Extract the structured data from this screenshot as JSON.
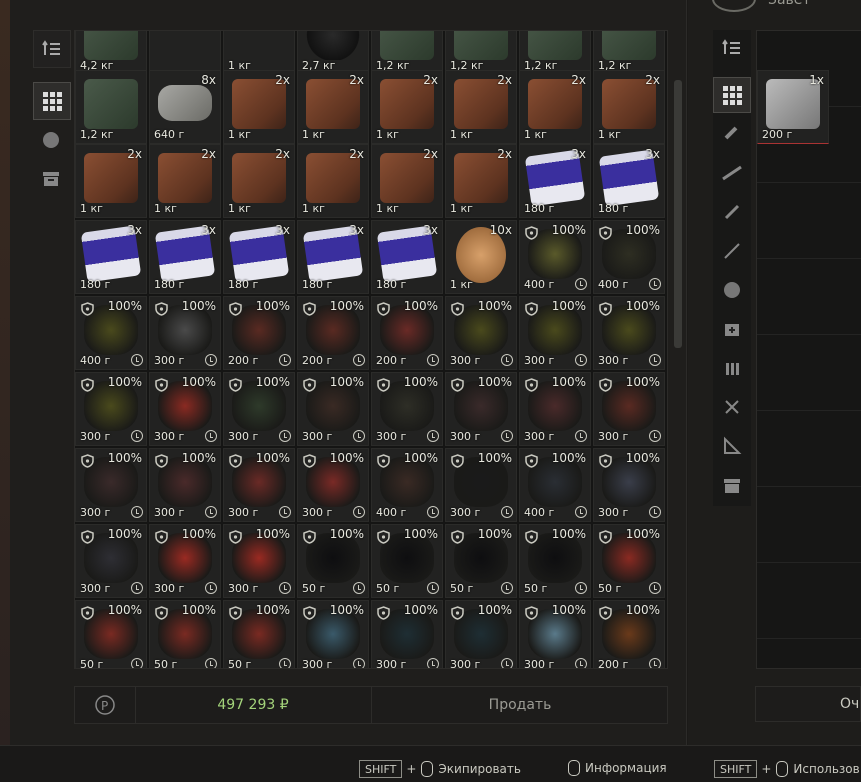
{
  "right_panel": {
    "title": "Завет"
  },
  "sell": {
    "total": "497 293 ₽",
    "sell_label": "Продать",
    "clear_label": "Оч"
  },
  "hints": [
    {
      "key": "SHIFT",
      "plus": "+",
      "label": "Экипировать"
    },
    {
      "label": "Информация"
    },
    {
      "key": "SHIFT",
      "plus": "+",
      "label": "Использов"
    }
  ],
  "right_item": {
    "count": "1x",
    "weight": "200 г"
  },
  "rows": [
    [
      {
        "w": "4,2 кг",
        "t": "chip"
      },
      {
        "w": "",
        "t": "empty"
      },
      {
        "w": "1 кг",
        "t": "organic"
      },
      {
        "w": "2,7 кг",
        "t": "dark"
      },
      {
        "w": "1,2 кг",
        "t": "chip"
      },
      {
        "w": "1,2 кг",
        "t": "chip"
      },
      {
        "w": "1,2 кг",
        "t": "chip"
      },
      {
        "w": "1,2 кг",
        "t": "chip"
      }
    ],
    [
      {
        "w": "1,2 кг",
        "t": "chip"
      },
      {
        "w": "640 г",
        "c": "8x",
        "t": "ctrl"
      },
      {
        "w": "1 кг",
        "c": "2x",
        "t": "book"
      },
      {
        "w": "1 кг",
        "c": "2x",
        "t": "book"
      },
      {
        "w": "1 кг",
        "c": "2x",
        "t": "book"
      },
      {
        "w": "1 кг",
        "c": "2x",
        "t": "book"
      },
      {
        "w": "1 кг",
        "c": "2x",
        "t": "book"
      },
      {
        "w": "1 кг",
        "c": "2x",
        "t": "book"
      }
    ],
    [
      {
        "w": "1 кг",
        "c": "2x",
        "t": "book"
      },
      {
        "w": "1 кг",
        "c": "2x",
        "t": "book"
      },
      {
        "w": "1 кг",
        "c": "2x",
        "t": "book"
      },
      {
        "w": "1 кг",
        "c": "2x",
        "t": "book"
      },
      {
        "w": "1 кг",
        "c": "2x",
        "t": "book"
      },
      {
        "w": "1 кг",
        "c": "2x",
        "t": "book"
      },
      {
        "w": "180 г",
        "c": "3x",
        "t": "cig"
      },
      {
        "w": "180 г",
        "c": "3x",
        "t": "cig"
      }
    ],
    [
      {
        "w": "180 г",
        "c": "3x",
        "t": "cig"
      },
      {
        "w": "180 г",
        "c": "3x",
        "t": "cig"
      },
      {
        "w": "180 г",
        "c": "3x",
        "t": "cig"
      },
      {
        "w": "180 г",
        "c": "3x",
        "t": "cig"
      },
      {
        "w": "180 г",
        "c": "3x",
        "t": "cig"
      },
      {
        "w": "1 кг",
        "c": "10x",
        "t": "coin"
      },
      {
        "w": "400 г",
        "p": "100%",
        "t": "o",
        "col": "#5a5a2a"
      },
      {
        "w": "400 г",
        "p": "100%",
        "t": "o",
        "col": "#2e2e22"
      }
    ],
    [
      {
        "w": "400 г",
        "p": "100%",
        "t": "o",
        "col": "#4a4a1c"
      },
      {
        "w": "300 г",
        "p": "100%",
        "t": "o",
        "col": "#4a4a4a"
      },
      {
        "w": "200 г",
        "p": "100%",
        "t": "o",
        "col": "#5a2a22"
      },
      {
        "w": "200 г",
        "p": "100%",
        "t": "o",
        "col": "#5a2a22"
      },
      {
        "w": "200 г",
        "p": "100%",
        "t": "o",
        "col": "#6a2a26"
      },
      {
        "w": "300 г",
        "p": "100%",
        "t": "o",
        "col": "#4a4a1c"
      },
      {
        "w": "300 г",
        "p": "100%",
        "t": "o",
        "col": "#4a4a1c"
      },
      {
        "w": "300 г",
        "p": "100%",
        "t": "o",
        "col": "#4a4a1c"
      }
    ],
    [
      {
        "w": "300 г",
        "p": "100%",
        "t": "o",
        "col": "#4a4a1c"
      },
      {
        "w": "300 г",
        "p": "100%",
        "t": "o",
        "col": "#8a2a22"
      },
      {
        "w": "300 г",
        "p": "100%",
        "t": "o",
        "col": "#2e3a2a"
      },
      {
        "w": "300 г",
        "p": "100%",
        "t": "o",
        "col": "#3a2a24"
      },
      {
        "w": "300 г",
        "p": "100%",
        "t": "o",
        "col": "#2e2e26"
      },
      {
        "w": "300 г",
        "p": "100%",
        "t": "o",
        "col": "#3a2a2a"
      },
      {
        "w": "300 г",
        "p": "100%",
        "t": "o",
        "col": "#4a2a2a"
      },
      {
        "w": "300 г",
        "p": "100%",
        "t": "o",
        "col": "#5a2a22"
      }
    ],
    [
      {
        "w": "300 г",
        "p": "100%",
        "t": "o",
        "col": "#3a2a2a"
      },
      {
        "w": "300 г",
        "p": "100%",
        "t": "o",
        "col": "#4a2a2a"
      },
      {
        "w": "300 г",
        "p": "100%",
        "t": "o",
        "col": "#6a2a26"
      },
      {
        "w": "300 г",
        "p": "100%",
        "t": "o",
        "col": "#7a2a26"
      },
      {
        "w": "400 г",
        "p": "100%",
        "t": "o",
        "col": "#3a2a24"
      },
      {
        "w": "300 г",
        "p": "100%",
        "t": "o",
        "col": "#1a1a1a"
      },
      {
        "w": "400 г",
        "p": "100%",
        "t": "o",
        "col": "#2a2e34"
      },
      {
        "w": "300 г",
        "p": "100%",
        "t": "o",
        "col": "#3a3e4a"
      }
    ],
    [
      {
        "w": "300 г",
        "p": "100%",
        "t": "o",
        "col": "#2e2e34"
      },
      {
        "w": "300 г",
        "p": "100%",
        "t": "o",
        "col": "#9a2a22"
      },
      {
        "w": "300 г",
        "p": "100%",
        "t": "o",
        "col": "#9a2a22"
      },
      {
        "w": "50 г",
        "p": "100%",
        "t": "o",
        "col": "#0e0e10"
      },
      {
        "w": "50 г",
        "p": "100%",
        "t": "o",
        "col": "#0e0e10"
      },
      {
        "w": "50 г",
        "p": "100%",
        "t": "o",
        "col": "#0e0e10"
      },
      {
        "w": "50 г",
        "p": "100%",
        "t": "o",
        "col": "#0e0e10"
      },
      {
        "w": "50 г",
        "p": "100%",
        "t": "o",
        "col": "#8a2a22"
      }
    ],
    [
      {
        "w": "50 г",
        "p": "100%",
        "t": "o",
        "col": "#7a2a22"
      },
      {
        "w": "50 г",
        "p": "100%",
        "t": "o",
        "col": "#7a2a22"
      },
      {
        "w": "50 г",
        "p": "100%",
        "t": "o",
        "col": "#7a2a22"
      },
      {
        "w": "300 г",
        "p": "100%",
        "t": "o",
        "col": "#3a5a6a"
      },
      {
        "w": "300 г",
        "p": "100%",
        "t": "o",
        "col": "#1e2e34"
      },
      {
        "w": "300 г",
        "p": "100%",
        "t": "o",
        "col": "#1e2e34"
      },
      {
        "w": "300 г",
        "p": "100%",
        "t": "o",
        "col": "#5a7a8a"
      },
      {
        "w": "200 г",
        "p": "100%",
        "t": "o",
        "col": "#6a3a1a"
      }
    ]
  ]
}
